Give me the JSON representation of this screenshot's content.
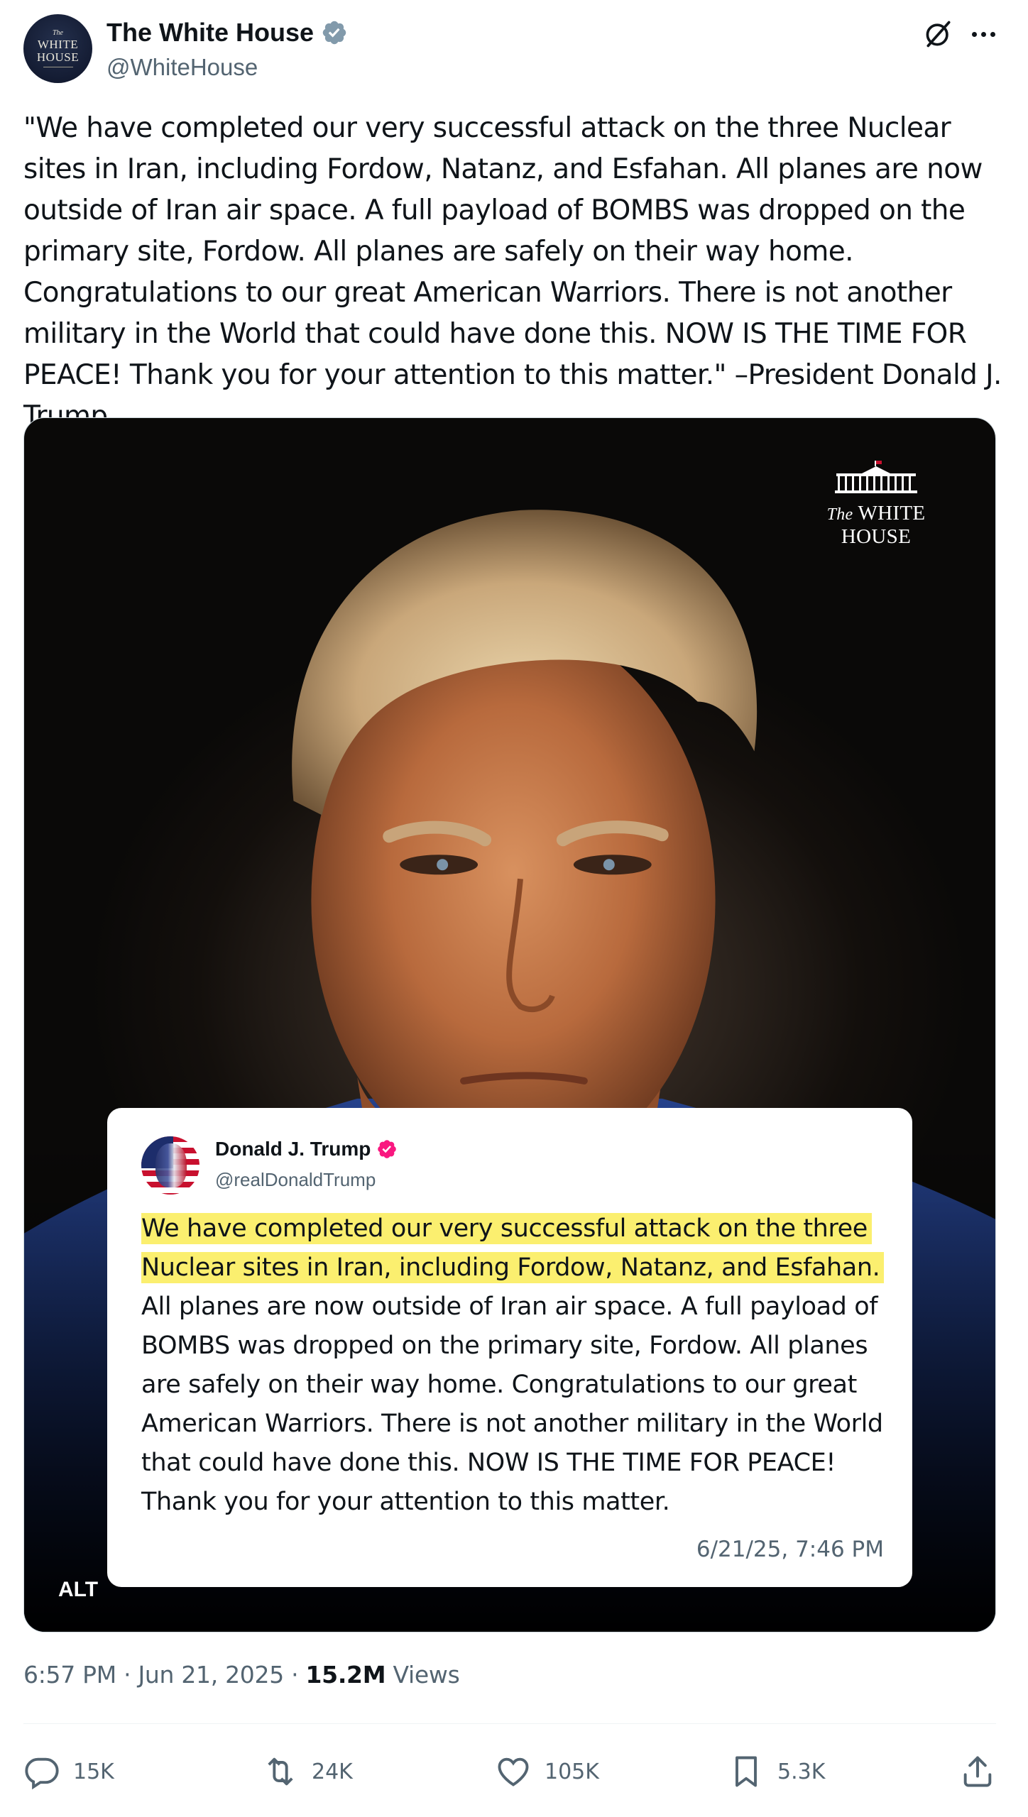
{
  "account": {
    "avatar_text_small": "The",
    "avatar_text_line1": "WHITE",
    "avatar_text_line2": "HOUSE",
    "display_name": "The White House",
    "handle": "@WhiteHouse",
    "verified_badge_color": "#829aab"
  },
  "header_icons": {
    "grok": "grok-icon",
    "more": "more-options-icon"
  },
  "tweet": {
    "text": "\"We have completed our very successful attack on the three Nuclear sites in Iran, including Fordow, Natanz, and Esfahan. All planes are now outside of Iran air space. A full payload of BOMBS was dropped on the primary site, Fordow. All planes are safely on their way home. Congratulations to our great American Warriors. There is not another military in the World that could have done this. NOW IS THE TIME FOR PEACE! Thank you for your attention to this matter.\" –President Donald J. Trump"
  },
  "media": {
    "logo_text_prefix": "The",
    "logo_text_main": "WHITE HOUSE",
    "alt_badge": "ALT",
    "quote_card": {
      "display_name": "Donald J. Trump",
      "handle": "@realDonaldTrump",
      "verified_badge_color": "#f91880",
      "highlight_color": "#fbef6f",
      "text_highlighted": "We have completed our very successful attack on the three Nuclear sites in Iran, including Fordow, Natanz, and Esfahan.",
      "text_rest": "All planes are now outside of Iran air space. A full payload of BOMBS was dropped on the primary site, Fordow. All planes are safely on their way home. Congratulations to our great American Warriors. There is not another military in the World that could have done this. NOW IS THE TIME FOR PEACE! Thank you for your attention to this matter.",
      "timestamp": "6/21/25, 7:46 PM"
    }
  },
  "meta": {
    "time": "6:57 PM",
    "separator": "·",
    "date": "Jun 21, 2025",
    "views_count": "15.2M",
    "views_label": "Views"
  },
  "actions": {
    "replies": "15K",
    "reposts": "24K",
    "likes": "105K",
    "bookmarks": "5.3K"
  }
}
